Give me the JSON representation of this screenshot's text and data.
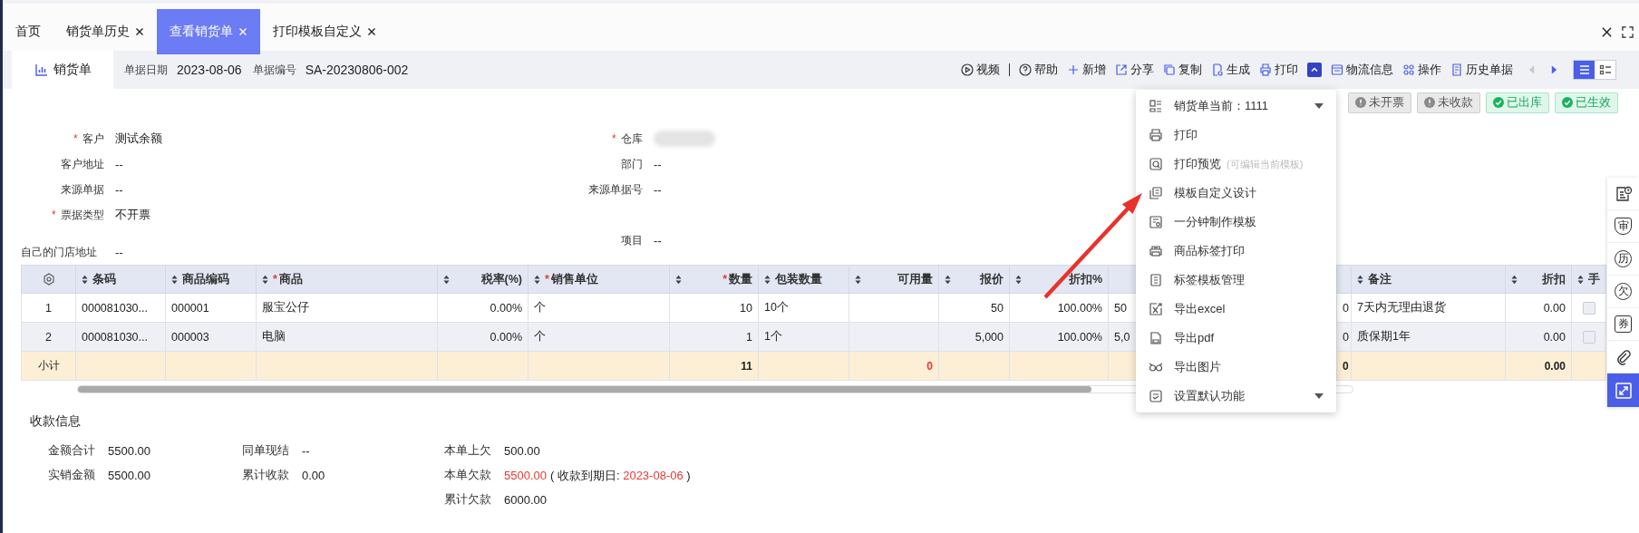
{
  "tabs": [
    {
      "label": "首页",
      "closable": false,
      "selected": false
    },
    {
      "label": "销货单历史",
      "closable": true,
      "selected": false
    },
    {
      "label": "查看销货单",
      "closable": true,
      "selected": true
    },
    {
      "label": "打印模板自定义",
      "closable": true,
      "selected": false
    }
  ],
  "doc_tab": {
    "label": "销货单"
  },
  "doc_meta": [
    {
      "label": "单据日期",
      "value": "2023-08-06"
    },
    {
      "label": "单据编号",
      "value": "SA-20230806-002"
    }
  ],
  "toolbar": [
    {
      "kind": "video",
      "label": "视频"
    },
    {
      "kind": "help",
      "label": "帮助"
    },
    {
      "kind": "add",
      "label": "新增"
    },
    {
      "kind": "share",
      "label": "分享"
    },
    {
      "kind": "copy",
      "label": "复制"
    },
    {
      "kind": "generate",
      "label": "生成"
    },
    {
      "kind": "print",
      "label": "打印"
    },
    {
      "kind": "collapse",
      "expanded": true
    },
    {
      "kind": "logistics",
      "label": "物流信息"
    },
    {
      "kind": "operate",
      "label": "操作"
    },
    {
      "kind": "history",
      "label": "历史单据"
    }
  ],
  "pager": {
    "prev_disabled": true,
    "next_disabled": false
  },
  "views": [
    {
      "kind": "list",
      "selected": true
    },
    {
      "kind": "detail",
      "selected": false
    }
  ],
  "status_tags": [
    {
      "label": "未开票",
      "kind": "pending"
    },
    {
      "label": "未收款",
      "kind": "pending"
    },
    {
      "label": "已出库",
      "kind": "done"
    },
    {
      "label": "已生效",
      "kind": "done"
    }
  ],
  "form": {
    "left": [
      {
        "label": "客户",
        "mark": "*",
        "value": "测试余额"
      },
      {
        "label": "客户地址",
        "value": "--"
      },
      {
        "label": "来源单据",
        "value": "--"
      },
      {
        "label": "票据类型",
        "mark": "*",
        "value": "不开票"
      }
    ],
    "middle": [
      {
        "label": "仓库",
        "mark": "*",
        "redacted": true
      },
      {
        "label": "部门",
        "value": "--"
      },
      {
        "label": "来源单据号",
        "value": "--"
      },
      {
        "label": "项目",
        "value": "--"
      }
    ]
  },
  "store_address": {
    "label": "自己的门店地址",
    "value": "--"
  },
  "table": {
    "columns": [
      {
        "label": "条码"
      },
      {
        "label": "商品编码"
      },
      {
        "label": "商品",
        "mark": "*"
      },
      {
        "label": "税率(%)"
      },
      {
        "label": "销售单位",
        "mark": "*"
      },
      {
        "label": "数量",
        "mark": "*"
      },
      {
        "label": "包装数量"
      },
      {
        "label": "可用量"
      },
      {
        "label": "报价"
      },
      {
        "label": "折扣%"
      },
      {
        "sortable": false
      },
      {
        "sortable": false
      },
      {
        "label": "备注"
      },
      {
        "label": "折扣"
      },
      {
        "label": "手"
      }
    ],
    "rows": [
      {
        "no": "1",
        "checked": false,
        "cells": [
          "000081030...",
          "000001",
          "服宝公仔",
          "0.00%",
          "个",
          "10",
          "10个",
          null,
          "50",
          "100.00%",
          "50",
          "0",
          "7天内无理由退货",
          "0.00"
        ]
      },
      {
        "no": "2",
        "checked": false,
        "cells": [
          "000081030...",
          "000003",
          "电脑",
          "0.00%",
          "个",
          "1",
          "1个",
          null,
          "5,000",
          "100.00%",
          "5,0",
          "0",
          "质保期1年",
          "0.00"
        ]
      }
    ],
    "subtotal": {
      "label": "小计",
      "cells": [
        null,
        null,
        null,
        null,
        null,
        {
          "text": "11"
        },
        null,
        {
          "text": "0",
          "alert": true
        },
        null,
        null,
        null,
        {
          "text": "0"
        },
        null,
        {
          "text": "0.00"
        }
      ]
    }
  },
  "print_menu": {
    "header": {
      "label": "销货单当前：1111"
    },
    "items": [
      {
        "kind": "print",
        "label": "打印"
      },
      {
        "kind": "preview",
        "label": "打印预览",
        "hint": "(可编辑当前模板)"
      },
      {
        "kind": "design",
        "label": "模板自定义设计"
      },
      {
        "kind": "quick",
        "label": "一分钟制作模板"
      },
      {
        "kind": "label-print",
        "label": "商品标签打印"
      },
      {
        "kind": "label-manage",
        "label": "标签模板管理"
      },
      {
        "kind": "excel",
        "label": "导出excel"
      },
      {
        "kind": "pdf",
        "label": "导出pdf"
      },
      {
        "kind": "image",
        "label": "导出图片"
      },
      {
        "kind": "settings",
        "label": "设置默认功能",
        "submenu": true
      }
    ]
  },
  "side_tools": [
    {
      "kind": "record",
      "selected": false
    },
    {
      "kind": "shield",
      "label": "审",
      "selected": false
    },
    {
      "kind": "circle",
      "label": "历",
      "selected": false
    },
    {
      "kind": "circle",
      "label": "欠",
      "selected": false
    },
    {
      "kind": "square",
      "label": "券",
      "selected": false
    },
    {
      "kind": "clip",
      "selected": false
    },
    {
      "kind": "expand",
      "selected": true
    }
  ],
  "payment": {
    "title": "收款信息",
    "groups": [
      [
        {
          "label": "金额合计",
          "value": "5500.00"
        },
        {
          "label": "实销金额",
          "value": "5500.00"
        }
      ],
      [
        {
          "label": "同单现结",
          "value": "--"
        },
        {
          "label": "累计收款",
          "value": "0.00"
        }
      ],
      [
        {
          "label": "本单上欠",
          "value": "500.00"
        },
        {
          "label": "本单欠款",
          "value": "5500.00",
          "alert": true,
          "note": {
            "prefix": "( 收款到期日: ",
            "date": "2023-08-06",
            "suffix": " )"
          }
        },
        {
          "label": "累计欠款",
          "value": "6000.00"
        }
      ]
    ]
  }
}
